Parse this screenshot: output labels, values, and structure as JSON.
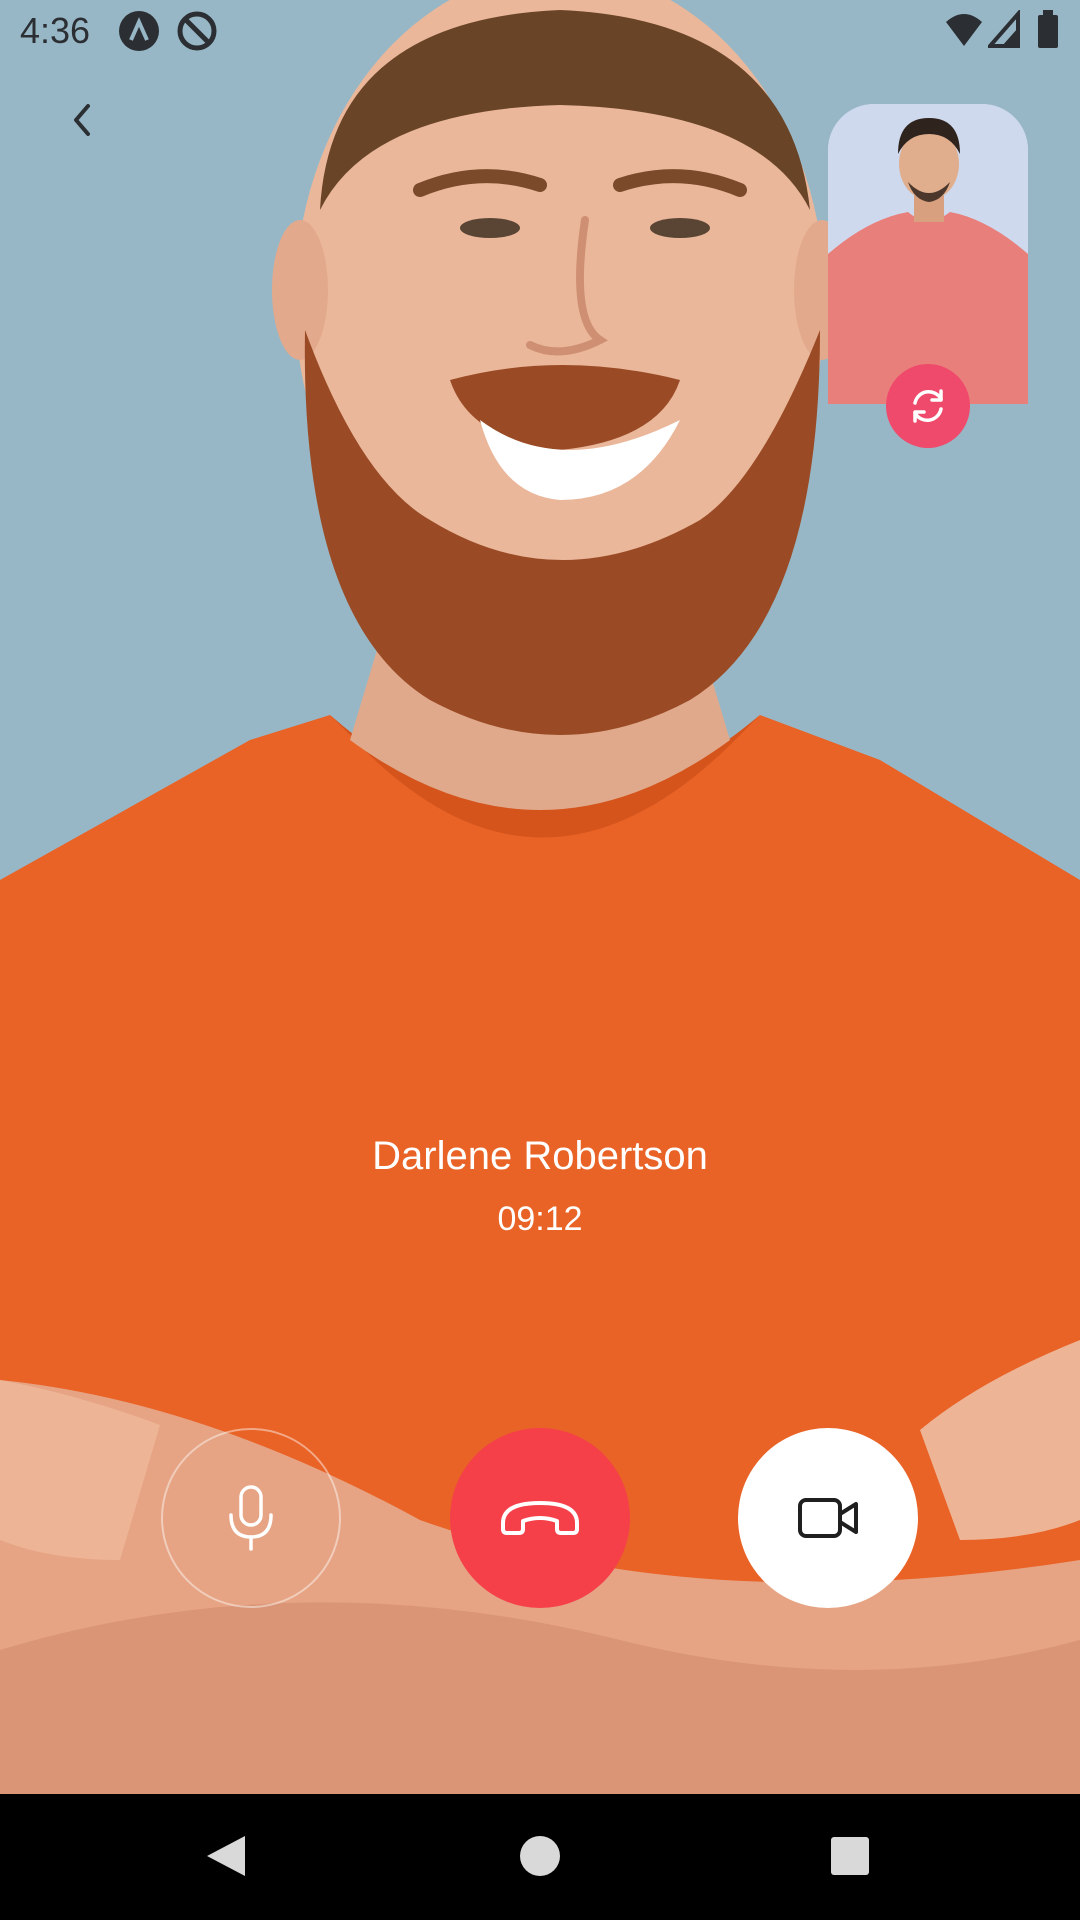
{
  "status_bar": {
    "time": "4:36",
    "left_icons": [
      "a-notification-icon",
      "at-sign-notification-icon"
    ],
    "right_icons": [
      "wifi-icon",
      "cell-signal-icon",
      "battery-icon"
    ]
  },
  "header": {
    "back_icon": "chevron-left-icon"
  },
  "self_preview": {
    "switch_icon": "camera-switch-icon",
    "accent_color": "#ef4a6b"
  },
  "caller": {
    "name": "Darlene Robertson",
    "duration": "09:12"
  },
  "controls": {
    "mic_icon": "microphone-icon",
    "end_call_icon": "phone-hangup-icon",
    "end_call_color": "#f5404a",
    "video_icon": "video-camera-icon"
  },
  "nav": {
    "back_icon": "triangle-back-icon",
    "home_icon": "circle-home-icon",
    "recents_icon": "square-recents-icon"
  }
}
